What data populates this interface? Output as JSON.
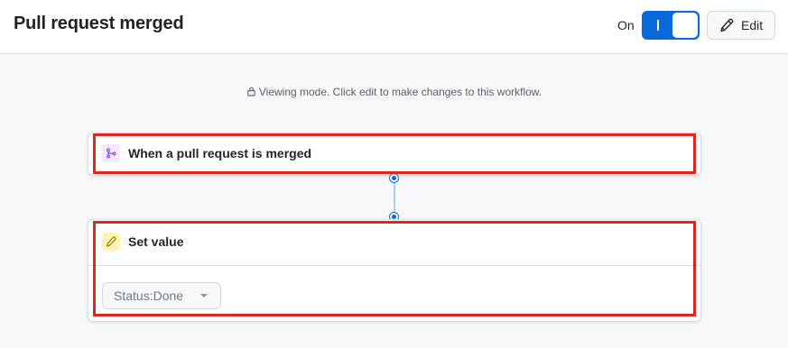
{
  "header": {
    "title": "Pull request merged",
    "toggle_label": "On",
    "toggle_state": "on",
    "edit_label": "Edit"
  },
  "notice": {
    "text": "Viewing mode. Click edit to make changes to this workflow.",
    "icon": "lock-icon"
  },
  "workflow": {
    "trigger": {
      "label": "When a pull request is merged",
      "icon": "git-merge-icon"
    },
    "action": {
      "label": "Set value",
      "icon": "pencil-icon",
      "select_value": "Status:Done"
    }
  },
  "colors": {
    "accent": "#0969da",
    "highlight": "#e0251b",
    "connector": "#a8d0f5"
  }
}
